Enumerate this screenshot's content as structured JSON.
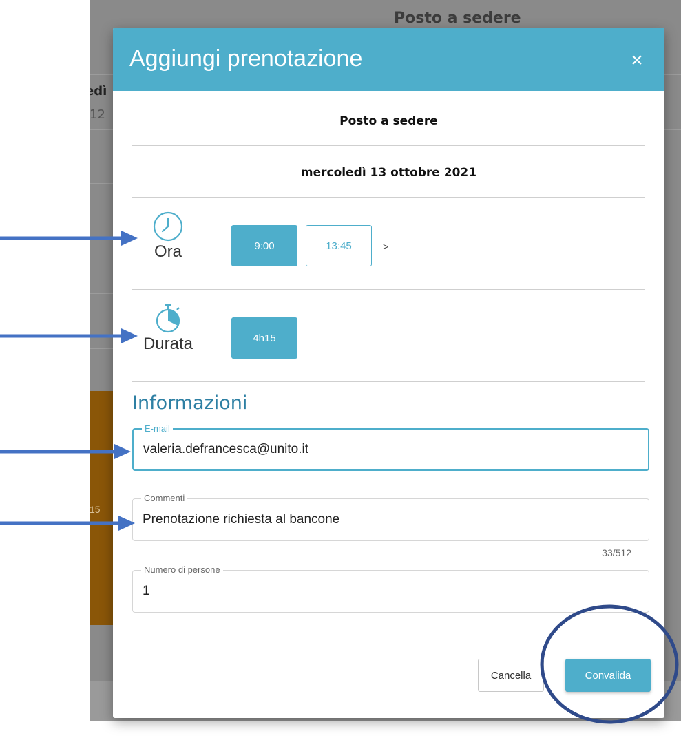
{
  "background": {
    "header_title": "Posto a sedere",
    "day_name": "edì",
    "day_number": "12",
    "event_time": "15"
  },
  "modal": {
    "title": "Aggiungi prenotazione",
    "close_glyph": "×",
    "resource": "Posto a sedere",
    "date": "mercoledì 13 ottobre 2021",
    "time": {
      "label": "Ora",
      "icon": "clock-icon",
      "slots": [
        "9:00",
        "13:45"
      ],
      "selected": "9:00",
      "next": ">"
    },
    "duration": {
      "label": "Durata",
      "icon": "stopwatch-icon",
      "options": [
        "4h15"
      ],
      "selected": "4h15"
    },
    "info_heading": "Informazioni",
    "fields": {
      "email": {
        "label": "E-mail",
        "value": "valeria.defrancesca@unito.it"
      },
      "comments": {
        "label": "Commenti",
        "value": "Prenotazione richiesta al bancone",
        "counter": "33/512"
      },
      "people": {
        "label": "Numero di persone",
        "value": "1"
      }
    },
    "buttons": {
      "cancel": "Cancella",
      "confirm": "Convalida"
    }
  },
  "colors": {
    "accent": "#4eaecb",
    "heading": "#2d7fa3",
    "annotation": "#4472c4",
    "annotation_circle": "#2f4a8a"
  }
}
